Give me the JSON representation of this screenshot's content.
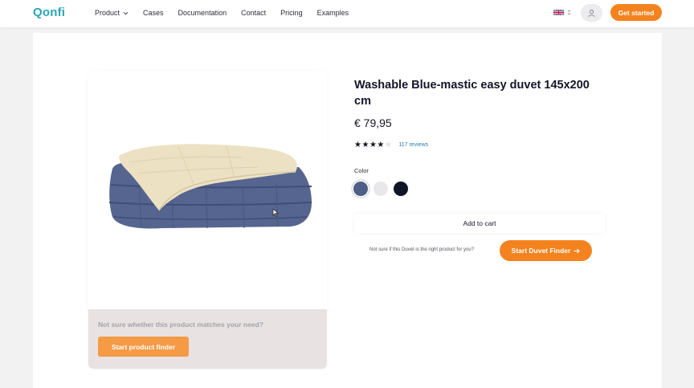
{
  "brand": {
    "name": "Qonfi"
  },
  "nav": {
    "items": [
      {
        "label": "Product",
        "has_dropdown": true
      },
      {
        "label": "Cases"
      },
      {
        "label": "Documentation"
      },
      {
        "label": "Contact"
      },
      {
        "label": "Pricing"
      },
      {
        "label": "Examples"
      }
    ],
    "language": "UK flag",
    "cta_label": "Get started"
  },
  "product": {
    "title": "Washable Blue-mastic easy duvet 145x200 cm",
    "price": "€ 79,95",
    "rating": 4,
    "max_rating": 5,
    "reviews_label": "117 reviews",
    "color_label": "Color",
    "colors": [
      {
        "name": "blue",
        "hex": "#4d5f86",
        "selected": true
      },
      {
        "name": "white",
        "hex": "#e8e8ea"
      },
      {
        "name": "black",
        "hex": "#0f1526"
      }
    ],
    "add_to_cart_label": "Add to cart",
    "not_sure_text": "Not sure if this Duvet is the right product for you?",
    "duvet_finder_label": "Start Duvet Finder"
  },
  "finder_panel": {
    "text": "Not sure whether this product matches your need?",
    "button_label": "Start product finder"
  },
  "colors": {
    "accent": "#f4831f",
    "brand": "#2aa6b3",
    "link": "#2c7bb0"
  },
  "icons": [
    "chevron-down-icon",
    "uk-flag-icon",
    "sort-arrows-icon",
    "user-icon",
    "arrow-right-icon",
    "star-icon",
    "cursor-icon"
  ]
}
